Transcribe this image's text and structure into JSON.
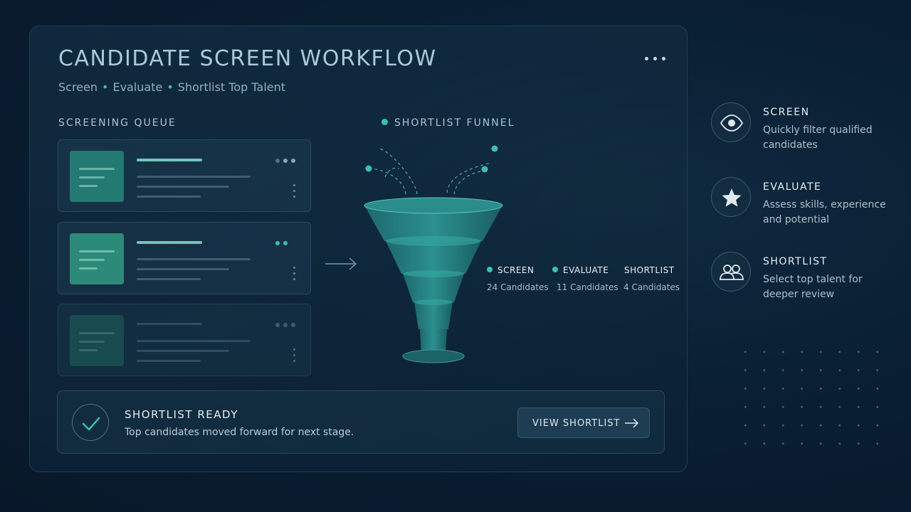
{
  "header": {
    "title": "CANDIDATE SCREEN WORKFLOW",
    "subtitle_parts": [
      "Screen",
      "Evaluate",
      "Shortlist Top Talent"
    ]
  },
  "queue": {
    "label": "SCREENING QUEUE"
  },
  "funnel": {
    "label": "SHORTLIST FUNNEL",
    "stages": [
      {
        "name": "SCREEN",
        "count": "24 Candidates"
      },
      {
        "name": "EVALUATE",
        "count": "11 Candidates"
      },
      {
        "name": "SHORTLIST",
        "count": "4 Candidates"
      }
    ]
  },
  "ready": {
    "title": "SHORTLIST READY",
    "description": "Top candidates moved forward for next stage.",
    "button_label": "VIEW SHORTLIST"
  },
  "features": [
    {
      "title": "SCREEN",
      "description": "Quickly filter qualified candidates",
      "icon": "eye-icon"
    },
    {
      "title": "EVALUATE",
      "description": "Assess skills, experience and potential",
      "icon": "star-icon"
    },
    {
      "title": "SHORTLIST",
      "description": "Select top talent for deeper review",
      "icon": "people-icon"
    }
  ],
  "colors": {
    "accent": "#3cc0a9",
    "background": "#0a1f33",
    "panel_border": "#1f3f55"
  }
}
